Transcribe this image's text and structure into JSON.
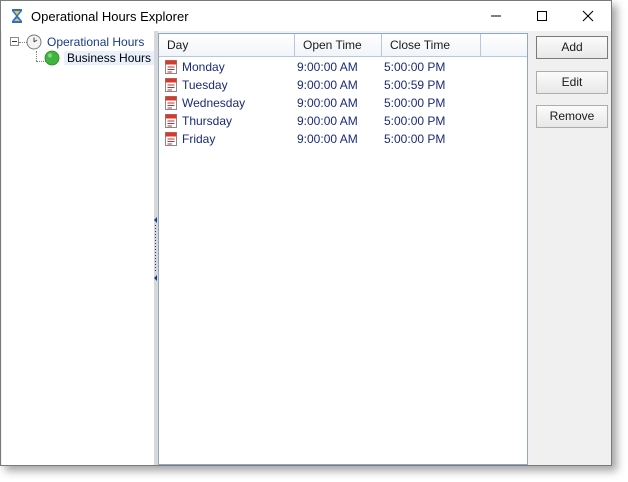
{
  "window": {
    "title": "Operational Hours Explorer",
    "app_icon": "hourglass-icon",
    "caption_buttons": [
      "minimize-icon",
      "maximize-icon",
      "close-icon"
    ]
  },
  "tree": {
    "root": {
      "label": "Operational Hours",
      "icon": "clock-icon",
      "expanded": true
    },
    "child": {
      "label": "Business Hours",
      "icon": "green-circle-icon",
      "selected": true
    }
  },
  "list": {
    "columns": [
      "Day",
      "Open Time",
      "Close Time"
    ],
    "row_icon": "calendar-icon",
    "rows": [
      {
        "day": "Monday",
        "open": "9:00:00 AM",
        "close": "5:00:00 PM"
      },
      {
        "day": "Tuesday",
        "open": "9:00:00 AM",
        "close": "5:00:59 PM"
      },
      {
        "day": "Wednesday",
        "open": "9:00:00 AM",
        "close": "5:00:00 PM"
      },
      {
        "day": "Thursday",
        "open": "9:00:00 AM",
        "close": "5:00:00 PM"
      },
      {
        "day": "Friday",
        "open": "9:00:00 AM",
        "close": "5:00:00 PM"
      }
    ]
  },
  "actions": {
    "add_label": "Add",
    "edit_label": "Edit",
    "remove_label": "Remove"
  },
  "colors": {
    "list_text": "#1b2a7a",
    "selection_dot": "#3fb53f",
    "list_border": "#8fa7c8"
  }
}
